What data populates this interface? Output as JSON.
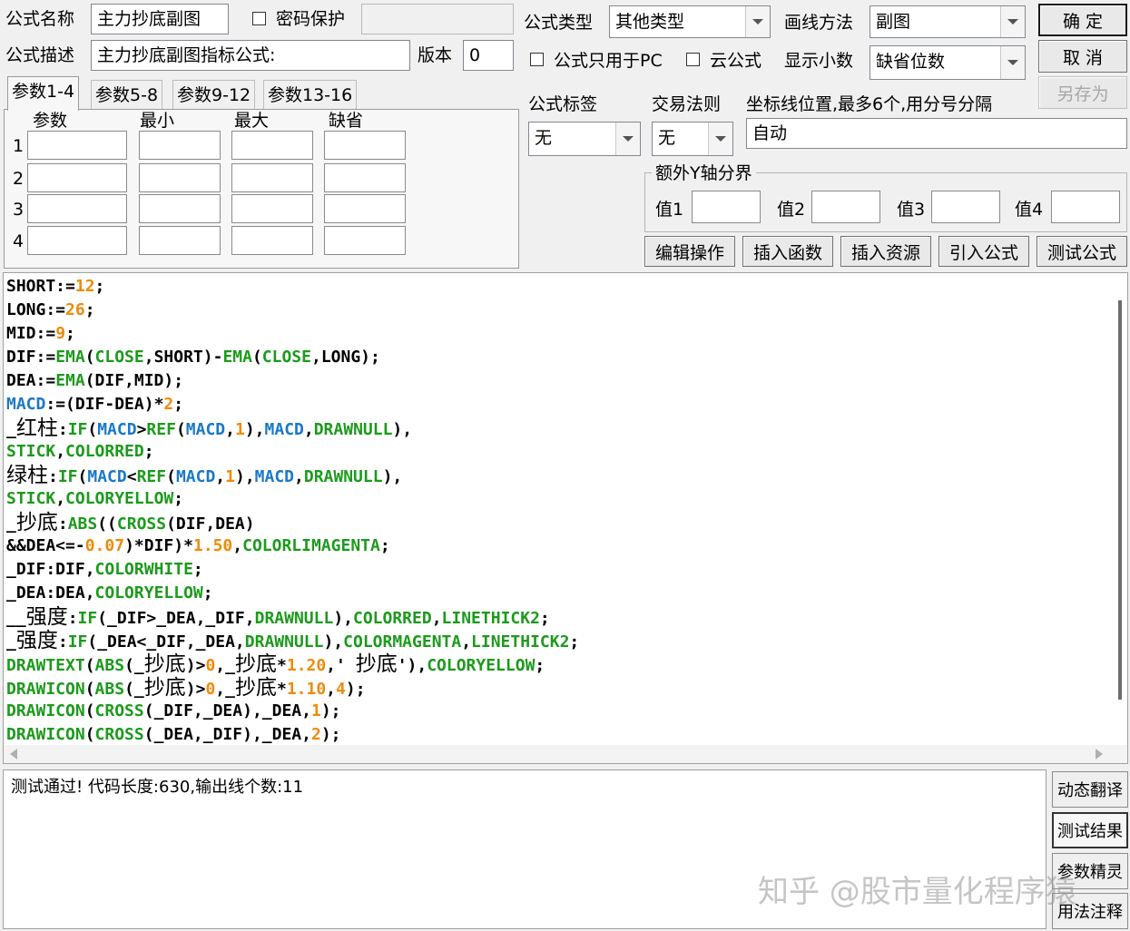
{
  "header": {
    "name_label": "公式名称",
    "name_value": "主力抄底副图",
    "password_label": "密码保护",
    "desc_label": "公式描述",
    "desc_value": "主力抄底副图指标公式:",
    "version_label": "版本",
    "version_value": "0",
    "type_label": "公式类型",
    "type_value": "其他类型",
    "draw_label": "画线方法",
    "draw_value": "副图",
    "pc_only_label": "公式只用于PC",
    "cloud_label": "云公式",
    "decimals_label": "显示小数",
    "decimals_value": "缺省位数",
    "ok_label": "确  定",
    "cancel_label": "取  消",
    "saveas_label": "另存为"
  },
  "params": {
    "tabs": [
      "参数1-4",
      "参数5-8",
      "参数9-12",
      "参数13-16"
    ],
    "columns": [
      "参数",
      "最小",
      "最大",
      "缺省"
    ],
    "rows": [
      "1",
      "2",
      "3",
      "4"
    ]
  },
  "right_panel": {
    "tag_label": "公式标签",
    "tag_value": "无",
    "rule_label": "交易法则",
    "rule_value": "无",
    "axis_label": "坐标线位置,最多6个,用分号分隔",
    "axis_value": "自动",
    "extra_y_label": "额外Y轴分界",
    "values": [
      "值1",
      "值2",
      "值3",
      "值4"
    ]
  },
  "toolbar": [
    "编辑操作",
    "插入函数",
    "插入资源",
    "引入公式",
    "测试公式"
  ],
  "code_lines": [
    [
      [
        "n",
        "SHORT:="
      ],
      [
        "o",
        "12"
      ],
      [
        "n",
        ";"
      ]
    ],
    [
      [
        "n",
        "LONG:="
      ],
      [
        "o",
        "26"
      ],
      [
        "n",
        ";"
      ]
    ],
    [
      [
        "n",
        "MID:="
      ],
      [
        "o",
        "9"
      ],
      [
        "n",
        ";"
      ]
    ],
    [
      [
        "n",
        "DIF:="
      ],
      [
        "g",
        "EMA"
      ],
      [
        "n",
        "("
      ],
      [
        "g",
        "CLOSE"
      ],
      [
        "n",
        ",SHORT)-"
      ],
      [
        "g",
        "EMA"
      ],
      [
        "n",
        "("
      ],
      [
        "g",
        "CLOSE"
      ],
      [
        "n",
        ",LONG);"
      ]
    ],
    [
      [
        "n",
        "DEA:="
      ],
      [
        "g",
        "EMA"
      ],
      [
        "n",
        "(DIF,MID);"
      ]
    ],
    [
      [
        "b",
        "MACD"
      ],
      [
        "n",
        ":=(DIF-DEA)*"
      ],
      [
        "o",
        "2"
      ],
      [
        "n",
        ";"
      ]
    ],
    [
      [
        "n",
        "_"
      ],
      [
        "cn",
        "红柱"
      ],
      [
        "n",
        ":"
      ],
      [
        "g",
        "IF"
      ],
      [
        "n",
        "("
      ],
      [
        "b",
        "MACD"
      ],
      [
        "n",
        ">"
      ],
      [
        "g",
        "REF"
      ],
      [
        "n",
        "("
      ],
      [
        "b",
        "MACD"
      ],
      [
        "n",
        ","
      ],
      [
        "o",
        "1"
      ],
      [
        "n",
        "),"
      ],
      [
        "b",
        "MACD"
      ],
      [
        "n",
        ","
      ],
      [
        "g",
        "DRAWNULL"
      ],
      [
        "n",
        "),"
      ]
    ],
    [
      [
        "g",
        "STICK"
      ],
      [
        "n",
        ","
      ],
      [
        "g",
        "COLORRED"
      ],
      [
        "n",
        ";"
      ]
    ],
    [
      [
        "cn",
        "绿柱"
      ],
      [
        "n",
        ":"
      ],
      [
        "g",
        "IF"
      ],
      [
        "n",
        "("
      ],
      [
        "b",
        "MACD"
      ],
      [
        "n",
        "<"
      ],
      [
        "g",
        "REF"
      ],
      [
        "n",
        "("
      ],
      [
        "b",
        "MACD"
      ],
      [
        "n",
        ","
      ],
      [
        "o",
        "1"
      ],
      [
        "n",
        "),"
      ],
      [
        "b",
        "MACD"
      ],
      [
        "n",
        ","
      ],
      [
        "g",
        "DRAWNULL"
      ],
      [
        "n",
        "),"
      ]
    ],
    [
      [
        "g",
        "STICK"
      ],
      [
        "n",
        ","
      ],
      [
        "g",
        "COLORYELLOW"
      ],
      [
        "n",
        ";"
      ]
    ],
    [
      [
        "n",
        "_"
      ],
      [
        "cn",
        "抄底"
      ],
      [
        "n",
        ":"
      ],
      [
        "g",
        "ABS"
      ],
      [
        "n",
        "(("
      ],
      [
        "g",
        "CROSS"
      ],
      [
        "n",
        "(DIF,DEA)"
      ]
    ],
    [
      [
        "n",
        "&&DEA<=-"
      ],
      [
        "o",
        "0.07"
      ],
      [
        "n",
        ")*DIF)*"
      ],
      [
        "o",
        "1.50"
      ],
      [
        "n",
        ","
      ],
      [
        "g",
        "COLORLIMAGENTA"
      ],
      [
        "n",
        ";"
      ]
    ],
    [
      [
        "n",
        "_DIF:DIF,"
      ],
      [
        "g",
        "COLORWHITE"
      ],
      [
        "n",
        ";"
      ]
    ],
    [
      [
        "n",
        "_DEA:DEA,"
      ],
      [
        "g",
        "COLORYELLOW"
      ],
      [
        "n",
        ";"
      ]
    ],
    [
      [
        "n",
        "__"
      ],
      [
        "cn",
        "强度"
      ],
      [
        "n",
        ":"
      ],
      [
        "g",
        "IF"
      ],
      [
        "n",
        "(_DIF>_DEA,_DIF,"
      ],
      [
        "g",
        "DRAWNULL"
      ],
      [
        "n",
        "),"
      ],
      [
        "g",
        "COLORRED"
      ],
      [
        "n",
        ","
      ],
      [
        "g",
        "LINETHICK2"
      ],
      [
        "n",
        ";"
      ]
    ],
    [
      [
        "n",
        "_"
      ],
      [
        "cn",
        "强度"
      ],
      [
        "n",
        ":"
      ],
      [
        "g",
        "IF"
      ],
      [
        "n",
        "(_DEA<_DIF,_DEA,"
      ],
      [
        "g",
        "DRAWNULL"
      ],
      [
        "n",
        "),"
      ],
      [
        "g",
        "COLORMAGENTA"
      ],
      [
        "n",
        ","
      ],
      [
        "g",
        "LINETHICK2"
      ],
      [
        "n",
        ";"
      ]
    ],
    [
      [
        "g",
        "DRAWTEXT"
      ],
      [
        "n",
        "("
      ],
      [
        "g",
        "ABS"
      ],
      [
        "n",
        "(_"
      ],
      [
        "cn",
        "抄底"
      ],
      [
        "n",
        ")>"
      ],
      [
        "o",
        "0"
      ],
      [
        "n",
        ",_"
      ],
      [
        "cn",
        "抄底"
      ],
      [
        "n",
        "*"
      ],
      [
        "o",
        "1.20"
      ],
      [
        "n",
        ",' "
      ],
      [
        "cn",
        "抄底"
      ],
      [
        "n",
        "'),"
      ],
      [
        "g",
        "COLORYELLOW"
      ],
      [
        "n",
        ";"
      ]
    ],
    [
      [
        "g",
        "DRAWICON"
      ],
      [
        "n",
        "("
      ],
      [
        "g",
        "ABS"
      ],
      [
        "n",
        "(_"
      ],
      [
        "cn",
        "抄底"
      ],
      [
        "n",
        ")>"
      ],
      [
        "o",
        "0"
      ],
      [
        "n",
        ",_"
      ],
      [
        "cn",
        "抄底"
      ],
      [
        "n",
        "*"
      ],
      [
        "o",
        "1.10"
      ],
      [
        "n",
        ","
      ],
      [
        "o",
        "4"
      ],
      [
        "n",
        ");"
      ]
    ],
    [
      [
        "g",
        "DRAWICON"
      ],
      [
        "n",
        "("
      ],
      [
        "g",
        "CROSS"
      ],
      [
        "n",
        "(_DIF,_DEA),_DEA,"
      ],
      [
        "o",
        "1"
      ],
      [
        "n",
        ");"
      ]
    ],
    [
      [
        "g",
        "DRAWICON"
      ],
      [
        "n",
        "("
      ],
      [
        "g",
        "CROSS"
      ],
      [
        "n",
        "(_DEA,_DIF),_DEA,"
      ],
      [
        "o",
        "2"
      ],
      [
        "n",
        ");"
      ]
    ]
  ],
  "output_text": "测试通过! 代码长度:630,输出线个数:11",
  "side_buttons": [
    "动态翻译",
    "测试结果",
    "参数精灵",
    "用法注释"
  ],
  "watermark": "知乎 @股市量化程序猿",
  "colors": {
    "keyword": "#1c9a1c",
    "variable": "#1a78c8",
    "number": "#f08a0a"
  }
}
